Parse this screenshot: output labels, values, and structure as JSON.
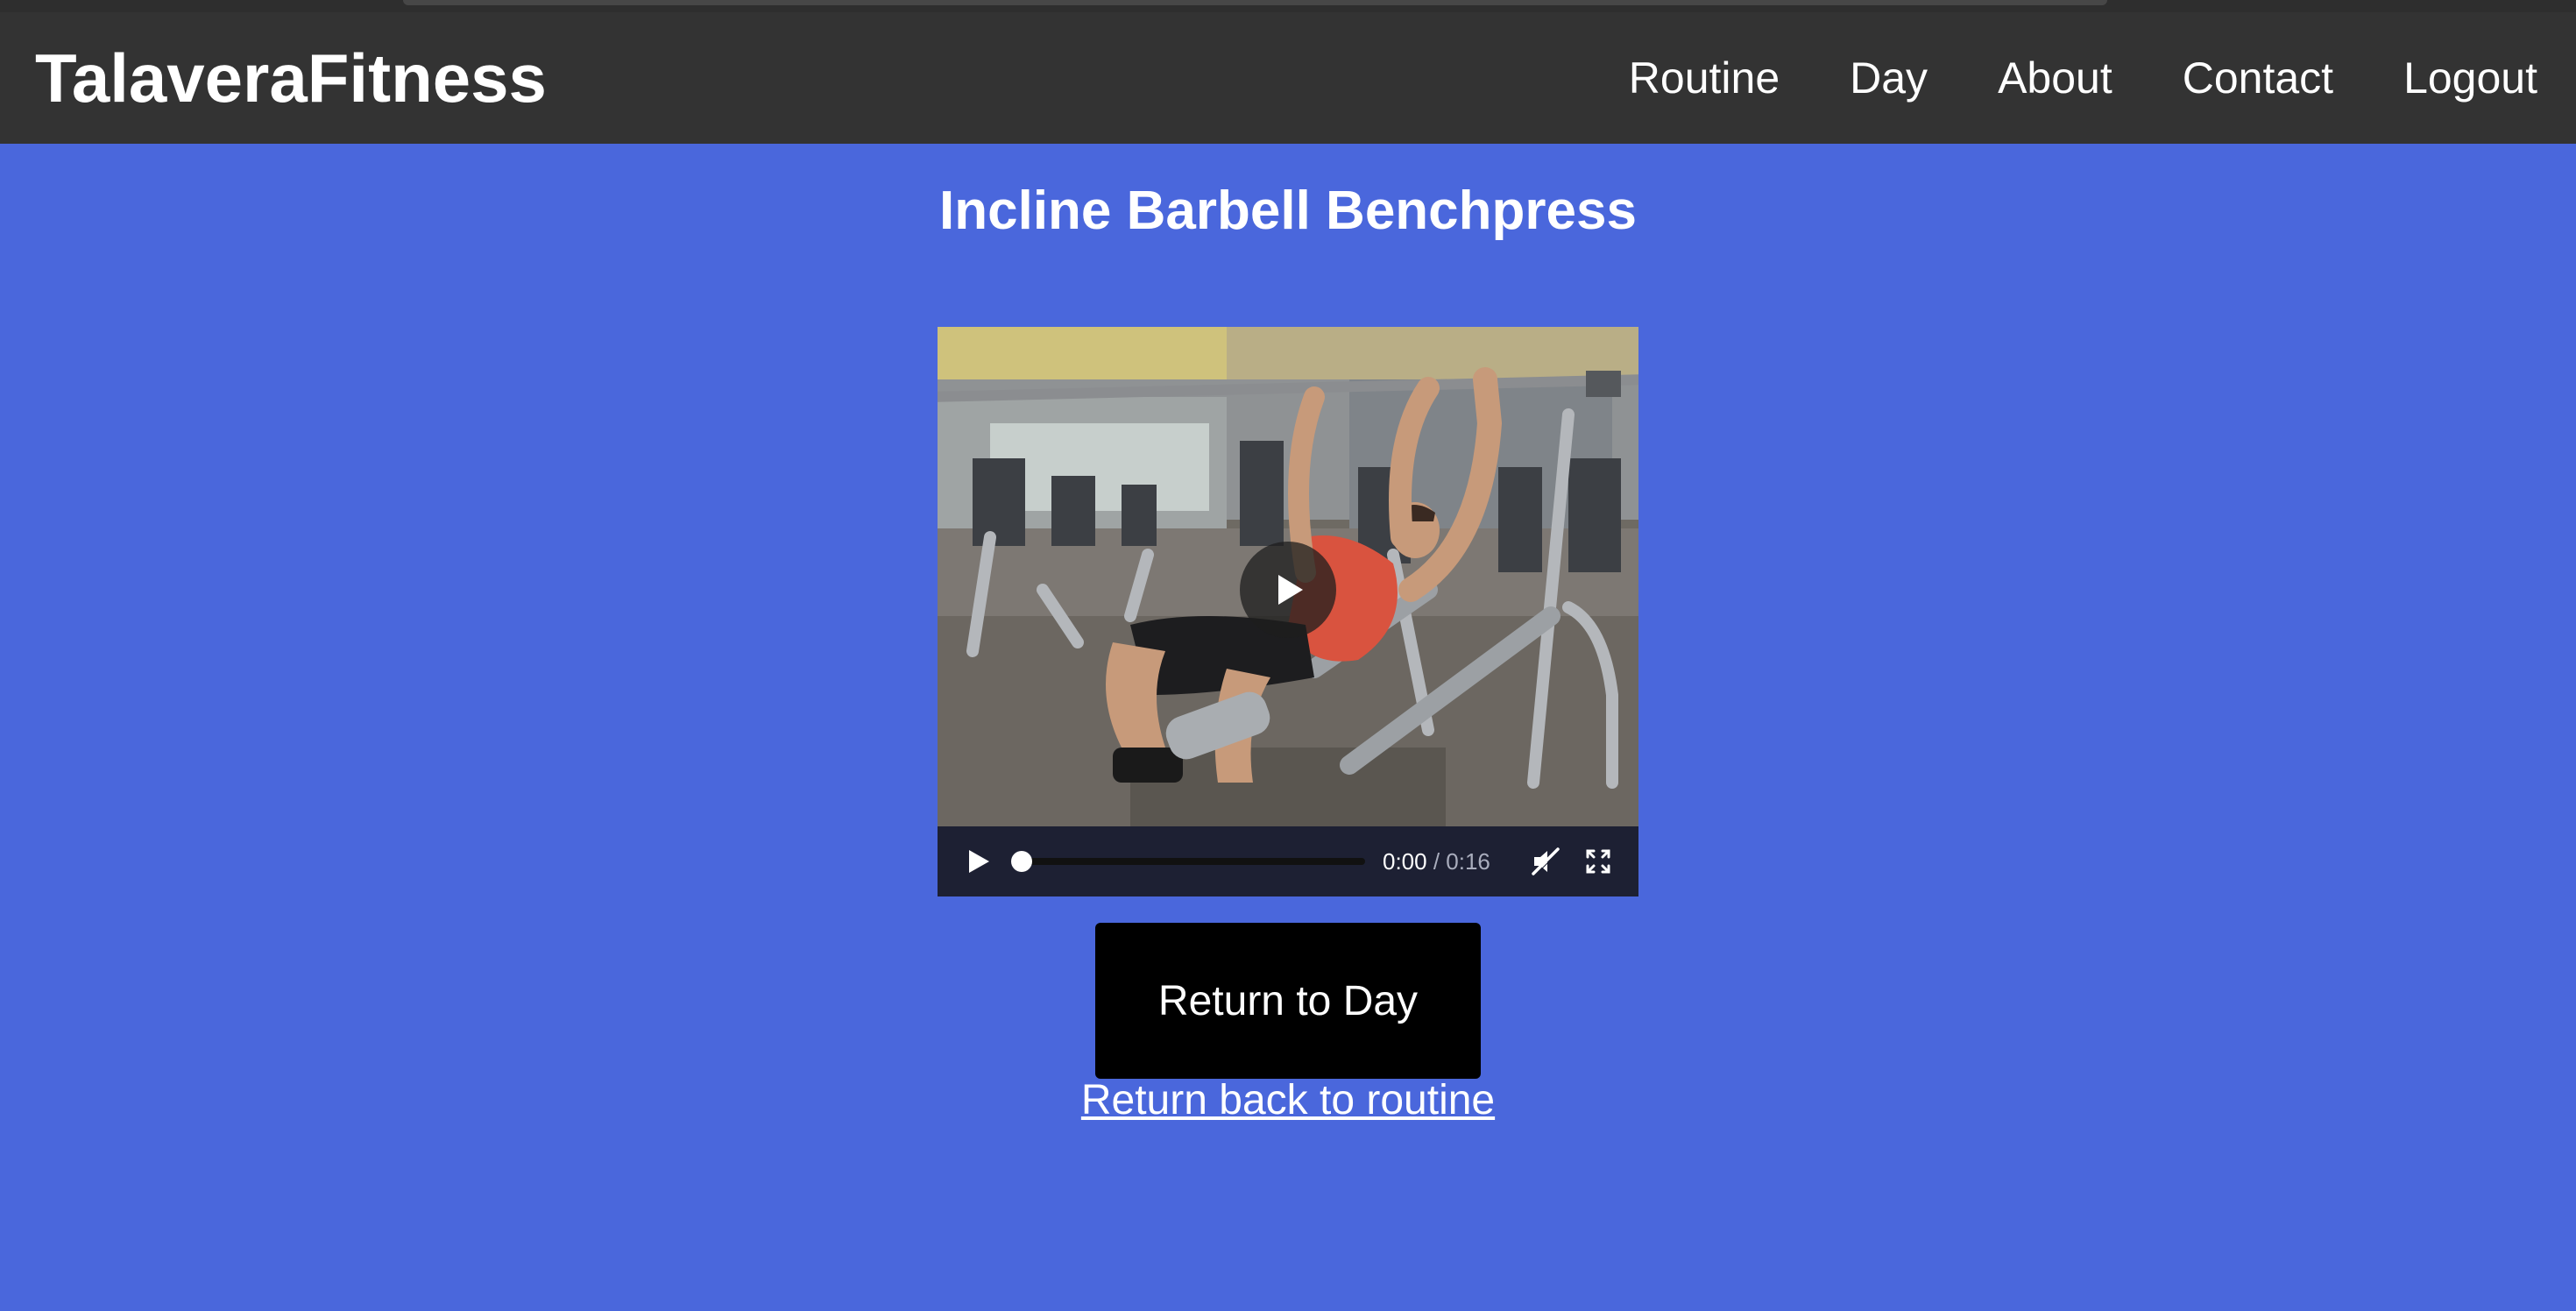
{
  "nav": {
    "brand": "TalaveraFitness",
    "links": [
      "Routine",
      "Day",
      "About",
      "Contact",
      "Logout"
    ]
  },
  "page": {
    "title": "Incline Barbell Benchpress"
  },
  "video": {
    "current_time": "0:00",
    "separator": " / ",
    "duration": "0:16",
    "progress": 0.0,
    "muted": true
  },
  "actions": {
    "return_day_label": "Return to Day",
    "return_routine_label": "Return back to routine"
  },
  "colors": {
    "page_background": "#4a67dc",
    "navbar_background": "#333333",
    "button_background": "#000000",
    "text": "#ffffff"
  },
  "icons": {
    "video_play": "play-icon",
    "control_play": "play-icon",
    "mute": "muted-speaker-icon",
    "fullscreen": "fullscreen-icon"
  }
}
